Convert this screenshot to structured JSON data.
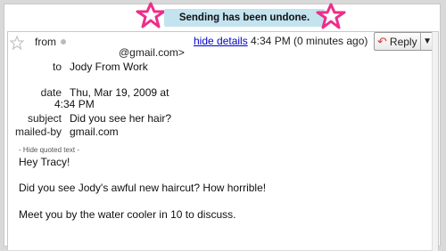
{
  "notice": {
    "text": "Sending has been undone."
  },
  "colors": {
    "notice_bg": "#c3e3ef",
    "star_pink": "#ee2d8a",
    "link": "#0000cc"
  },
  "message": {
    "from_label": "from",
    "from_email": "@gmail.com>",
    "hide_details": "hide details",
    "time": "4:34 PM (0 minutes ago)",
    "reply_label": "Reply",
    "reply_arrow": "↶",
    "reply_menu": "▼",
    "headers": {
      "to_label": "to",
      "to_value": "Jody From Work",
      "date_label": "date",
      "date_value_line1": "Thu, Mar 19, 2009 at",
      "date_value_line2": "4:34 PM",
      "subject_label": "subject",
      "subject_value": "Did you see her hair?",
      "mailedby_label": "mailed-by",
      "mailedby_value": "gmail.com"
    },
    "quoted_toggle": "- Hide quoted text -",
    "body": {
      "greeting": "Hey Tracy!",
      "line1": "Did you see Jody's awful new haircut? How horrible!",
      "line2": "Meet you by the water cooler in 10 to discuss."
    }
  },
  "icons": {
    "fav": "star-outline-icon",
    "decor": "pink-star-icon",
    "reply": "reply-arrow-icon",
    "menu": "dropdown-arrow-icon"
  }
}
